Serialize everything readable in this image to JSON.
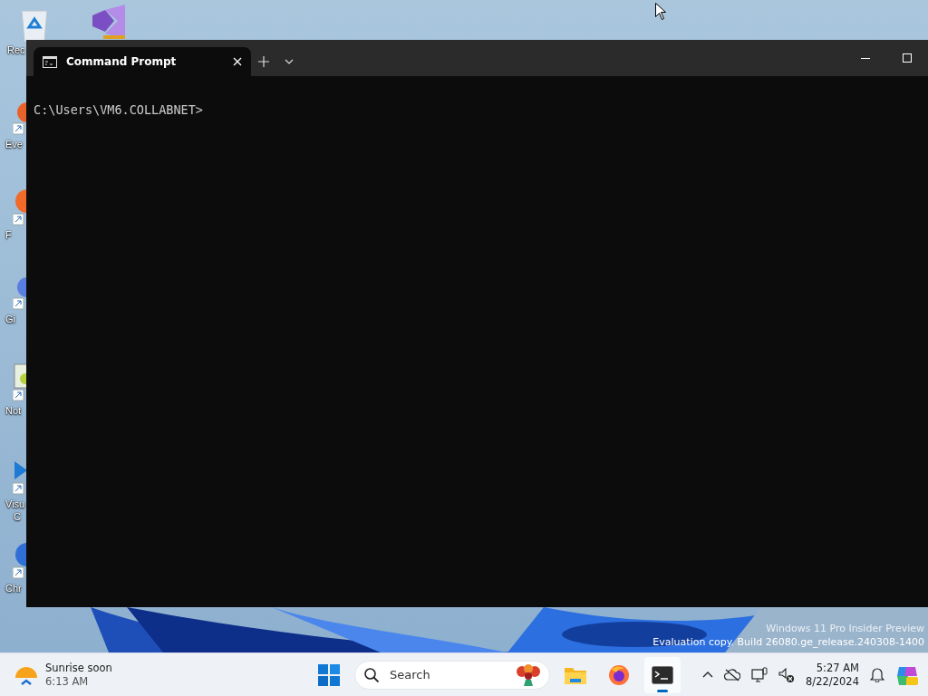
{
  "desktop": {
    "icons": [
      {
        "kind": "recycle",
        "label": "Rec"
      },
      {
        "kind": "studio"
      },
      {
        "kind": "orange",
        "label": "Eve"
      },
      {
        "kind": "firefox",
        "label": "F"
      },
      {
        "kind": "blue",
        "label": "Gi"
      },
      {
        "kind": "notepad",
        "label": "Not"
      },
      {
        "kind": "vscode",
        "label": "Visu",
        "label_2": "C"
      },
      {
        "kind": "chrome",
        "label": "Chr"
      }
    ],
    "watermark": {
      "line_1": "Windows 11 Pro Insider Preview",
      "line_2": "Evaluation copy. Build 26080.ge_release.240308-1400"
    }
  },
  "window": {
    "tabs": [
      {
        "label": "Command Prompt",
        "selected": true
      }
    ],
    "console_lines": [
      "C:\\Users\\VM6.COLLABNET>"
    ]
  },
  "taskbar": {
    "weather": {
      "title": "Sunrise soon",
      "subtitle": "6:13 AM"
    },
    "search": {
      "placeholder": "Search"
    },
    "apps": [
      {
        "kind": "explorer",
        "selected": false
      },
      {
        "kind": "firefox",
        "selected": false
      },
      {
        "kind": "terminal",
        "selected": true
      }
    ],
    "clock": {
      "time": "5:27 AM",
      "date": "8/22/2024"
    }
  }
}
